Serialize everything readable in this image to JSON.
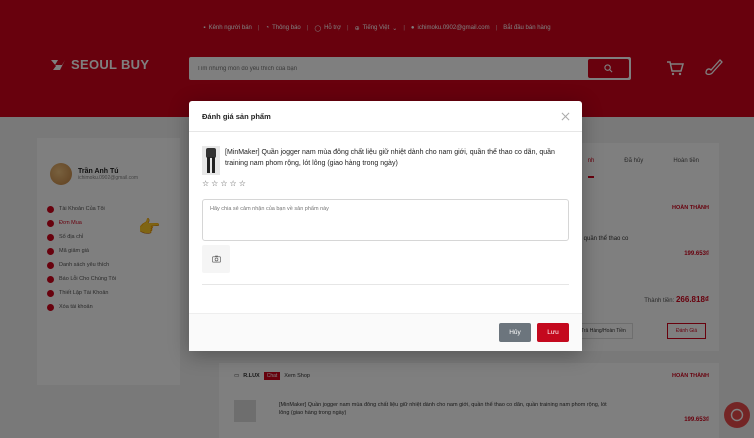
{
  "header": {
    "topbar": [
      "Kênh người bán",
      "Thông báo",
      "Hỗ trợ",
      "Tiếng Việt",
      "ichimoku.0902@gmail.com",
      "Bắt đầu bán hàng"
    ],
    "logo": "SEOUL BUY",
    "search_placeholder": "Tìm những món đồ yêu thích của bạn"
  },
  "sidebar": {
    "user_name": "Trần Anh Tú",
    "user_email": "ichimoku.0902@gmail.com",
    "items": [
      {
        "label": "Tài Khoản Của Tôi"
      },
      {
        "label": "Đơn Mua"
      },
      {
        "label": "Sổ địa chỉ"
      },
      {
        "label": "Mã giảm giá"
      },
      {
        "label": "Danh sách yêu thích"
      },
      {
        "label": "Báo Lỗi Cho Chúng Tôi"
      },
      {
        "label": "Thiết Lập Tài Khoản"
      },
      {
        "label": "Xóa tài khoản"
      }
    ]
  },
  "orders": {
    "tabs": [
      "nh",
      "Đã hủy",
      "Hoàn tiền"
    ],
    "status1": "HOÀN THÀNH",
    "product_snippet": "i, quần thể thao co",
    "price1": "199.653₫",
    "total_label": "Thành tiền:",
    "total_value": "266.818₫",
    "return_btn": "Trả Hàng/Hoàn Tiền",
    "rate_btn": "Đánh Giá",
    "shop2": "R.LUX",
    "chat_label": "Chat",
    "view_shop": "Xem Shop",
    "status2": "HOÀN THÀNH",
    "product2": "[MinMaker] Quần jogger nam mùa đông chất liệu giữ nhiệt dành cho nam giới, quần thể thao co dãn, quần training nam phom rộng, lót lông (giao hàng trong ngày)",
    "price2": "199.653₫"
  },
  "modal": {
    "title": "Đánh giá sản phẩm",
    "product_name": "[MinMaker] Quần jogger nam mùa đông chất liệu giữ nhiệt dành cho nam giới, quần thể thao co dãn, quần training nam phom rộng, lót lông (giao hàng trong ngày)",
    "stars": [
      "☆",
      "☆",
      "☆",
      "☆",
      "☆"
    ],
    "review_placeholder": "Hãy chia sẻ cảm nhận của bạn về sản phẩm này",
    "cancel_label": "Hủy",
    "save_label": "Lưu"
  },
  "colors": {
    "brand": "#d0021b",
    "cancel": "#6c757d",
    "save": "#c4091e"
  }
}
